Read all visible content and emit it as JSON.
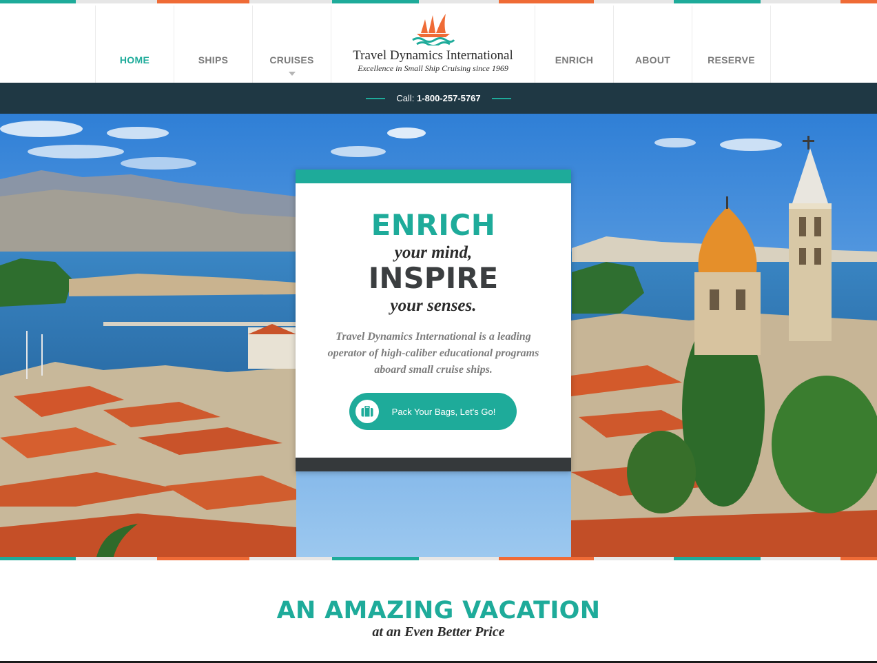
{
  "brand": {
    "name": "Travel Dynamics International",
    "tagline": "Excellence in Small Ship Cruising since 1969",
    "logo_icon": "sailboat-waves-icon"
  },
  "nav": {
    "left": [
      {
        "label": "HOME",
        "active": true
      },
      {
        "label": "SHIPS",
        "active": false
      },
      {
        "label": "CRUISES",
        "active": false,
        "has_dropdown": true
      }
    ],
    "right": [
      {
        "label": "ENRICH",
        "active": false
      },
      {
        "label": "ABOUT",
        "active": false
      },
      {
        "label": "RESERVE",
        "active": false
      }
    ]
  },
  "callbar": {
    "prefix": "Call:",
    "phone": "1-800-257-5767"
  },
  "hero": {
    "enrich": "ENRICH",
    "mind": "your mind,",
    "inspire": "INSPIRE",
    "senses": "your senses.",
    "body": "Travel Dynamics International is a leading operator of high-caliber educational programs aboard small cruise ships.",
    "cta_label": "Pack Your Bags, Let's Go!",
    "cta_icon": "suitcase-icon"
  },
  "section": {
    "title": "AN AMAZING VACATION",
    "subtitle": "at an Even Better Price"
  },
  "colors": {
    "teal": "#1eab9a",
    "orange": "#ef6b36",
    "navy": "#1f3844",
    "dark": "#35393b"
  }
}
